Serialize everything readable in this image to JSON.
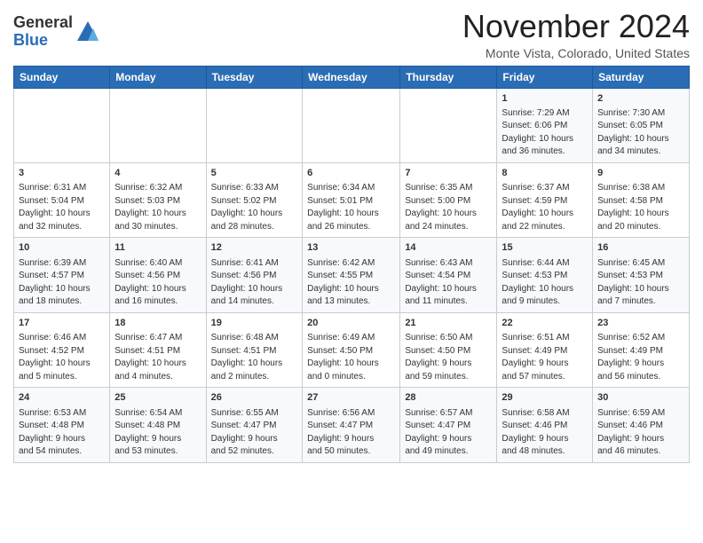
{
  "header": {
    "logo_general": "General",
    "logo_blue": "Blue",
    "month_title": "November 2024",
    "location": "Monte Vista, Colorado, United States"
  },
  "weekdays": [
    "Sunday",
    "Monday",
    "Tuesday",
    "Wednesday",
    "Thursday",
    "Friday",
    "Saturday"
  ],
  "weeks": [
    [
      {
        "day": "",
        "info": ""
      },
      {
        "day": "",
        "info": ""
      },
      {
        "day": "",
        "info": ""
      },
      {
        "day": "",
        "info": ""
      },
      {
        "day": "",
        "info": ""
      },
      {
        "day": "1",
        "info": "Sunrise: 7:29 AM\nSunset: 6:06 PM\nDaylight: 10 hours\nand 36 minutes."
      },
      {
        "day": "2",
        "info": "Sunrise: 7:30 AM\nSunset: 6:05 PM\nDaylight: 10 hours\nand 34 minutes."
      }
    ],
    [
      {
        "day": "3",
        "info": "Sunrise: 6:31 AM\nSunset: 5:04 PM\nDaylight: 10 hours\nand 32 minutes."
      },
      {
        "day": "4",
        "info": "Sunrise: 6:32 AM\nSunset: 5:03 PM\nDaylight: 10 hours\nand 30 minutes."
      },
      {
        "day": "5",
        "info": "Sunrise: 6:33 AM\nSunset: 5:02 PM\nDaylight: 10 hours\nand 28 minutes."
      },
      {
        "day": "6",
        "info": "Sunrise: 6:34 AM\nSunset: 5:01 PM\nDaylight: 10 hours\nand 26 minutes."
      },
      {
        "day": "7",
        "info": "Sunrise: 6:35 AM\nSunset: 5:00 PM\nDaylight: 10 hours\nand 24 minutes."
      },
      {
        "day": "8",
        "info": "Sunrise: 6:37 AM\nSunset: 4:59 PM\nDaylight: 10 hours\nand 22 minutes."
      },
      {
        "day": "9",
        "info": "Sunrise: 6:38 AM\nSunset: 4:58 PM\nDaylight: 10 hours\nand 20 minutes."
      }
    ],
    [
      {
        "day": "10",
        "info": "Sunrise: 6:39 AM\nSunset: 4:57 PM\nDaylight: 10 hours\nand 18 minutes."
      },
      {
        "day": "11",
        "info": "Sunrise: 6:40 AM\nSunset: 4:56 PM\nDaylight: 10 hours\nand 16 minutes."
      },
      {
        "day": "12",
        "info": "Sunrise: 6:41 AM\nSunset: 4:56 PM\nDaylight: 10 hours\nand 14 minutes."
      },
      {
        "day": "13",
        "info": "Sunrise: 6:42 AM\nSunset: 4:55 PM\nDaylight: 10 hours\nand 13 minutes."
      },
      {
        "day": "14",
        "info": "Sunrise: 6:43 AM\nSunset: 4:54 PM\nDaylight: 10 hours\nand 11 minutes."
      },
      {
        "day": "15",
        "info": "Sunrise: 6:44 AM\nSunset: 4:53 PM\nDaylight: 10 hours\nand 9 minutes."
      },
      {
        "day": "16",
        "info": "Sunrise: 6:45 AM\nSunset: 4:53 PM\nDaylight: 10 hours\nand 7 minutes."
      }
    ],
    [
      {
        "day": "17",
        "info": "Sunrise: 6:46 AM\nSunset: 4:52 PM\nDaylight: 10 hours\nand 5 minutes."
      },
      {
        "day": "18",
        "info": "Sunrise: 6:47 AM\nSunset: 4:51 PM\nDaylight: 10 hours\nand 4 minutes."
      },
      {
        "day": "19",
        "info": "Sunrise: 6:48 AM\nSunset: 4:51 PM\nDaylight: 10 hours\nand 2 minutes."
      },
      {
        "day": "20",
        "info": "Sunrise: 6:49 AM\nSunset: 4:50 PM\nDaylight: 10 hours\nand 0 minutes."
      },
      {
        "day": "21",
        "info": "Sunrise: 6:50 AM\nSunset: 4:50 PM\nDaylight: 9 hours\nand 59 minutes."
      },
      {
        "day": "22",
        "info": "Sunrise: 6:51 AM\nSunset: 4:49 PM\nDaylight: 9 hours\nand 57 minutes."
      },
      {
        "day": "23",
        "info": "Sunrise: 6:52 AM\nSunset: 4:49 PM\nDaylight: 9 hours\nand 56 minutes."
      }
    ],
    [
      {
        "day": "24",
        "info": "Sunrise: 6:53 AM\nSunset: 4:48 PM\nDaylight: 9 hours\nand 54 minutes."
      },
      {
        "day": "25",
        "info": "Sunrise: 6:54 AM\nSunset: 4:48 PM\nDaylight: 9 hours\nand 53 minutes."
      },
      {
        "day": "26",
        "info": "Sunrise: 6:55 AM\nSunset: 4:47 PM\nDaylight: 9 hours\nand 52 minutes."
      },
      {
        "day": "27",
        "info": "Sunrise: 6:56 AM\nSunset: 4:47 PM\nDaylight: 9 hours\nand 50 minutes."
      },
      {
        "day": "28",
        "info": "Sunrise: 6:57 AM\nSunset: 4:47 PM\nDaylight: 9 hours\nand 49 minutes."
      },
      {
        "day": "29",
        "info": "Sunrise: 6:58 AM\nSunset: 4:46 PM\nDaylight: 9 hours\nand 48 minutes."
      },
      {
        "day": "30",
        "info": "Sunrise: 6:59 AM\nSunset: 4:46 PM\nDaylight: 9 hours\nand 46 minutes."
      }
    ]
  ]
}
